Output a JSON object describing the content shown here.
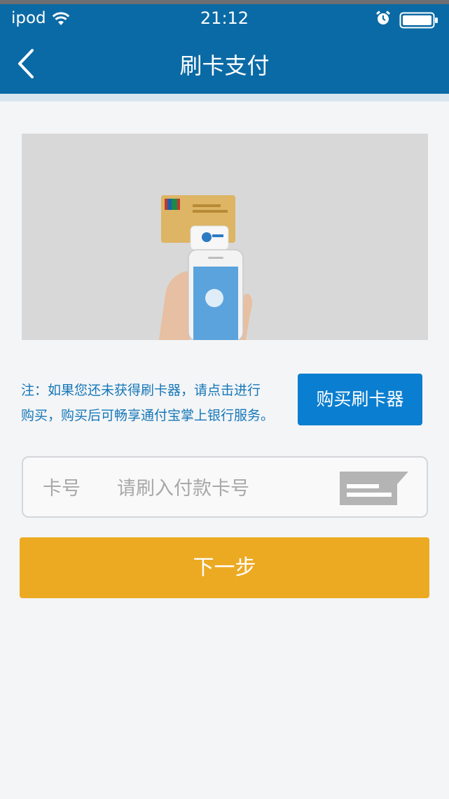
{
  "status_bar": {
    "carrier": "ipod",
    "time": "21:12",
    "icons": [
      "wifi-icon",
      "alarm-icon",
      "battery-icon"
    ]
  },
  "nav": {
    "title": "刷卡支付",
    "back_icon": "chevron-left-icon"
  },
  "hero": {
    "image": "card-reader-promo-image"
  },
  "note": {
    "line1": "注：如果您还未获得刷卡器，请点击进行",
    "line2": "购买，购买后可畅享通付宝掌上银行服务。"
  },
  "buy_button": {
    "label": "购买刷卡器"
  },
  "card_field": {
    "label": "卡号",
    "placeholder": "请刷入付款卡号",
    "icon": "card-reader-icon"
  },
  "next_button": {
    "label": "下一步"
  },
  "colors": {
    "nav_bg": "#0a6aa5",
    "page_bg": "#f4f5f7",
    "note_text": "#1577b8",
    "buy_button": "#0a7ed0",
    "next_button": "#ecaa23",
    "input_text": "#a8a8a8"
  }
}
